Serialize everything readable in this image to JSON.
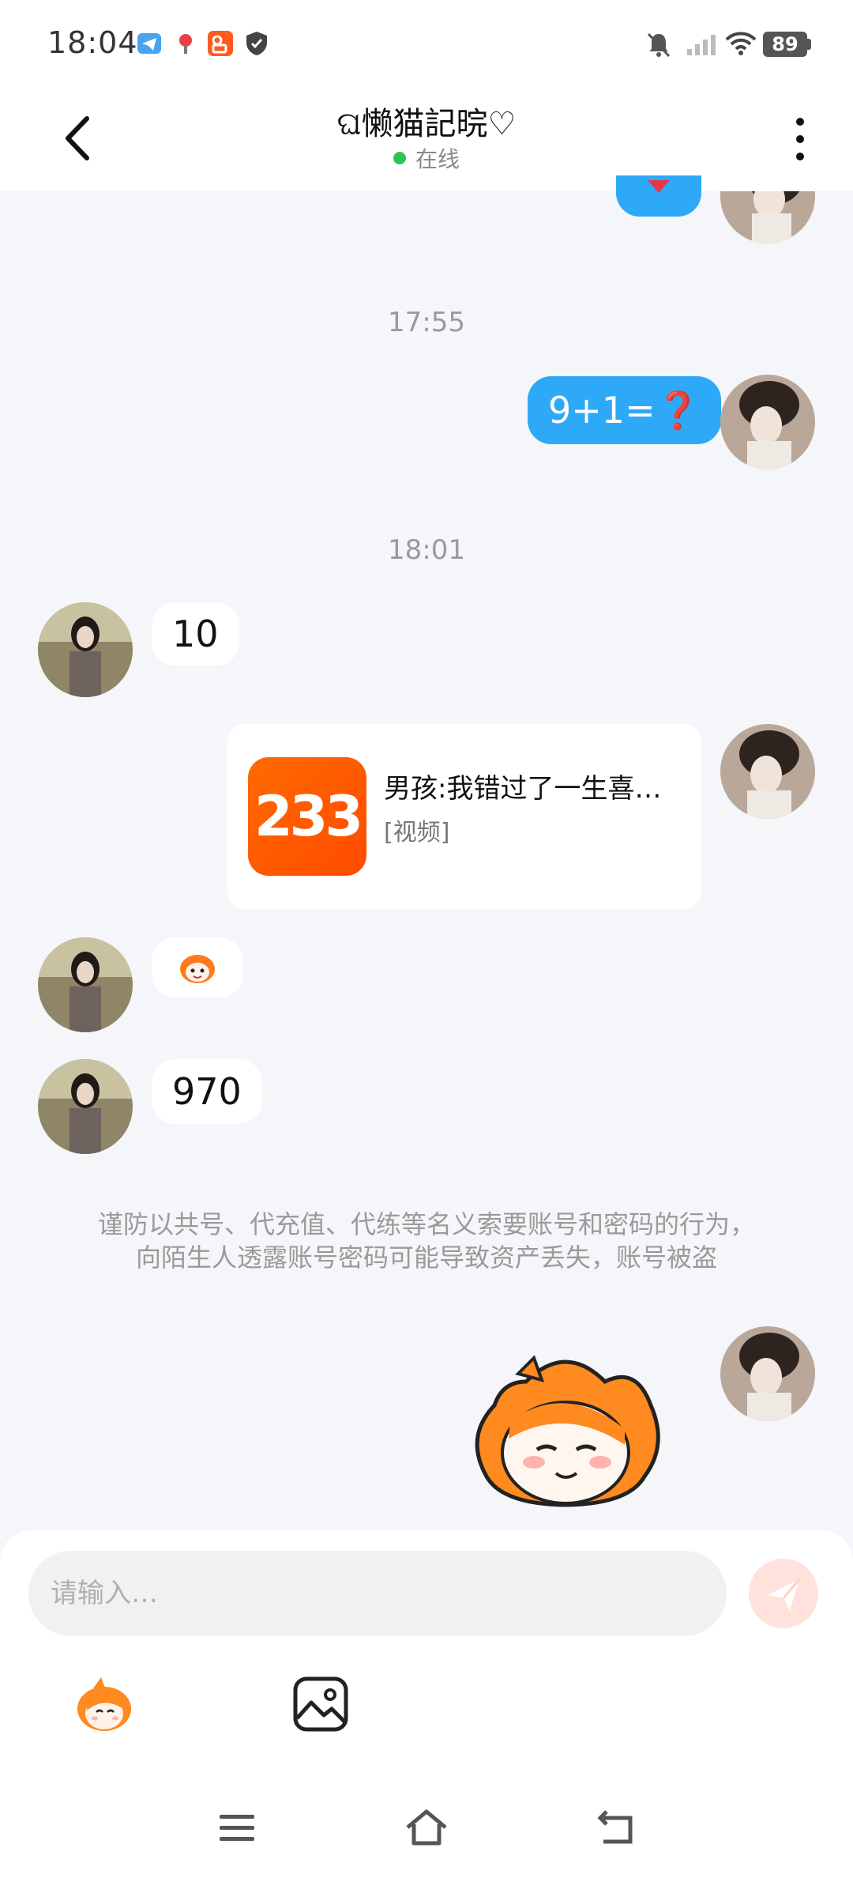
{
  "status_bar": {
    "time": "18:04",
    "battery": "89",
    "icons": [
      "telegram-like-icon",
      "map-pin-icon",
      "kuaishou-icon",
      "shield-icon",
      "mute-bell-icon",
      "signal-icon",
      "wifi-icon",
      "battery-icon"
    ]
  },
  "header": {
    "title": "ଘ懒猫記晥♡",
    "status": "在线",
    "status_color": "#2fc25b"
  },
  "messages": {
    "time_1": "17:55",
    "me_1": "9+1=❓",
    "time_2": "18:01",
    "other_1": "10",
    "share_logo_text": "233",
    "share_title": "男孩:我错过了一生喜…",
    "share_type": "[视频]",
    "other_3": "970",
    "notice_line_1": "谨防以共号、代充值、代练等名义索要账号和密码的行为，",
    "notice_line_2": "向陌生人透露账号密码可能导致资产丢失，账号被盗"
  },
  "input": {
    "placeholder": "请输入…"
  },
  "colors": {
    "my_bubble": "#2ea9f7",
    "background": "#f4f6f9",
    "send_button": "#ffe2dc",
    "mascot_orange": "#ff7a1a"
  }
}
